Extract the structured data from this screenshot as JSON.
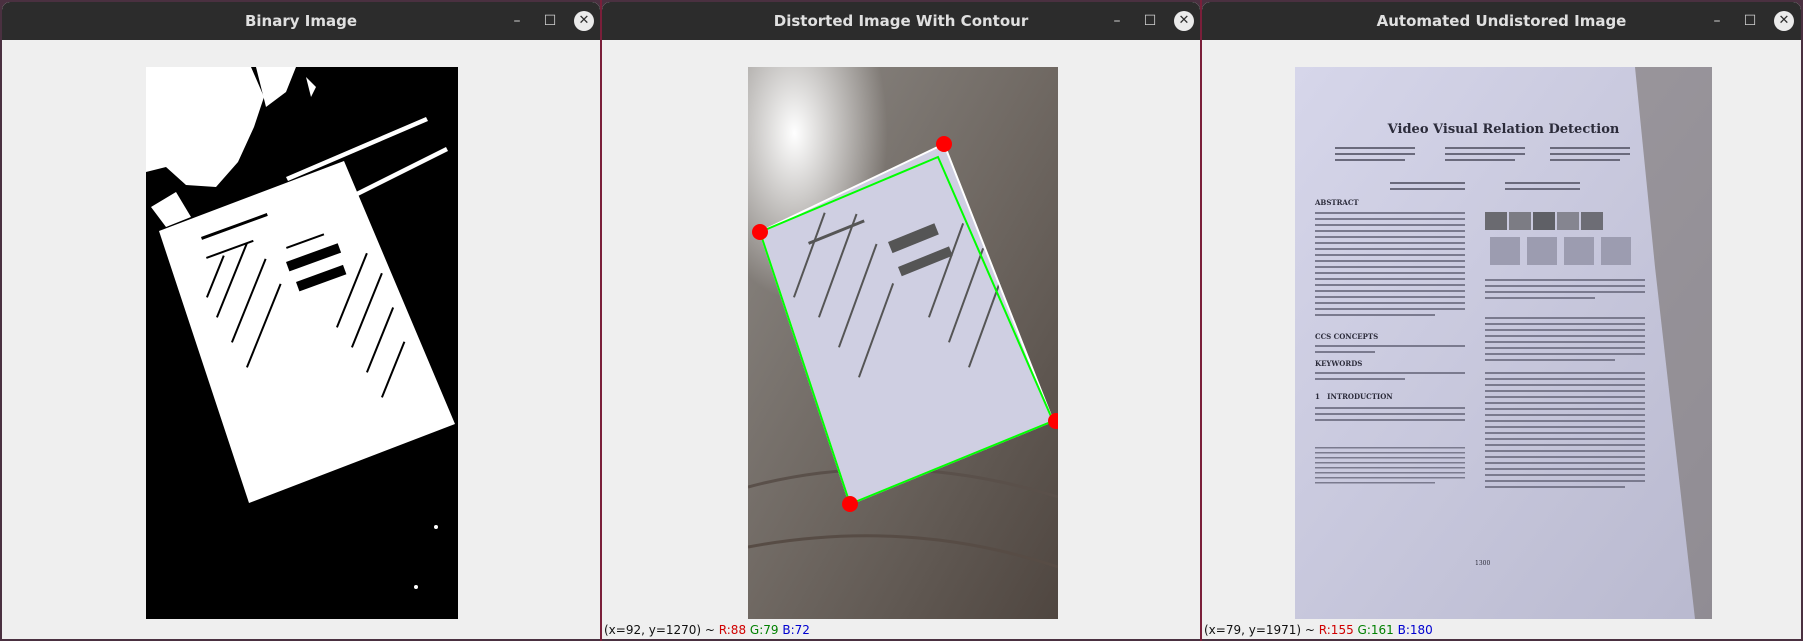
{
  "windows": [
    {
      "title": "Binary Image",
      "status": null
    },
    {
      "title": "Distorted Image With Contour",
      "status": {
        "coords": "(x=92, y=1270) ~ ",
        "r": "R:88",
        "g": "G:79",
        "b": "B:72"
      }
    },
    {
      "title": "Automated Undistored Image",
      "status": {
        "coords": "(x=79, y=1971) ~ ",
        "r": "R:155",
        "g": "G:161",
        "b": "B:180"
      }
    }
  ],
  "paper": {
    "title": "Video Visual Relation Detection",
    "sections": [
      "ABSTRACT",
      "CCS CONCEPTS",
      "KEYWORDS",
      "1   INTRODUCTION"
    ],
    "page_number": "1300"
  },
  "colors": {
    "titlebar": "#2c2c2c",
    "corner_marker": "#ff0000",
    "contour_line": "#00ff00",
    "status_r": "#d00000",
    "status_g": "#008000",
    "status_b": "#0000d0"
  }
}
